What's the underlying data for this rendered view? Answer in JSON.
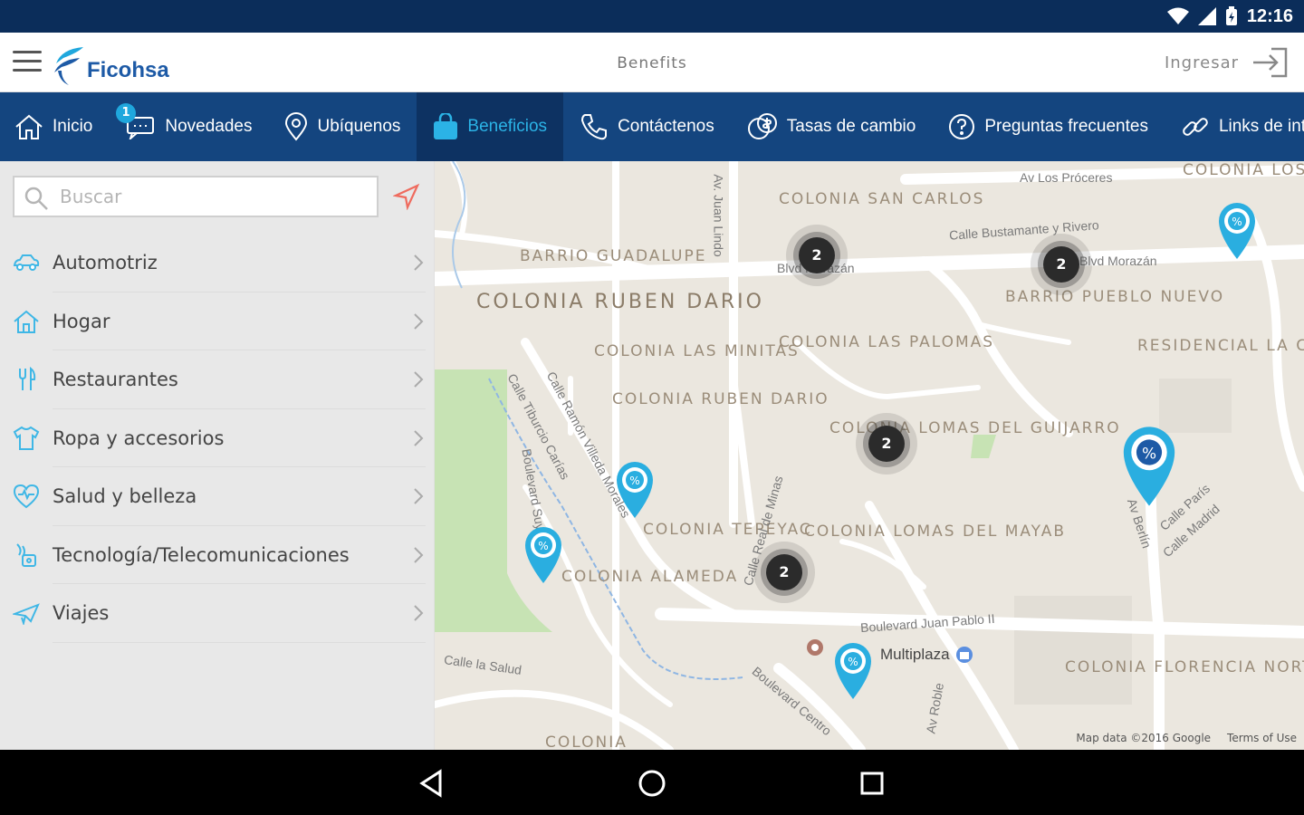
{
  "status": {
    "time": "12:16"
  },
  "appbar": {
    "brand": "Ficohsa",
    "title": "Benefits",
    "login_label": "Ingresar"
  },
  "colors": {
    "navy": "#14457f",
    "active_tab": "#0d3262",
    "accent": "#2bb3e6",
    "status_bar": "#0b2d5a"
  },
  "nav": {
    "badge": "1",
    "tabs": [
      {
        "label": "Inicio",
        "icon": "home-icon"
      },
      {
        "label": "Novedades",
        "icon": "chat-icon"
      },
      {
        "label": "Ubíquenos",
        "icon": "location-pin-icon"
      },
      {
        "label": "Beneficios",
        "icon": "shopping-bag-icon",
        "active": true
      },
      {
        "label": "Contáctenos",
        "icon": "phone-icon"
      },
      {
        "label": "Tasas de cambio",
        "icon": "currency-exchange-icon"
      },
      {
        "label": "Preguntas frecuentes",
        "icon": "help-icon"
      },
      {
        "label": "Links de inter",
        "icon": "link-icon"
      }
    ]
  },
  "sidebar": {
    "search_placeholder": "Buscar",
    "categories": [
      {
        "label": "Automotriz",
        "icon": "car-icon"
      },
      {
        "label": "Hogar",
        "icon": "house-icon"
      },
      {
        "label": "Restaurantes",
        "icon": "fork-knife-icon"
      },
      {
        "label": "Ropa y accesorios",
        "icon": "shirt-icon"
      },
      {
        "label": "Salud y belleza",
        "icon": "heart-icon"
      },
      {
        "label": "Tecnología/Telecomunicaciones",
        "icon": "technology-icon"
      },
      {
        "label": "Viajes",
        "icon": "plane-icon"
      }
    ]
  },
  "map": {
    "neighborhoods": [
      "COLONIA SAN CARLOS",
      "BARRIO GUADALUPE",
      "COLONIA RUBEN DARIO",
      "COLONIA LAS MINITAS",
      "COLONIA RUBEN DARIO",
      "COLONIA LAS PALOMAS",
      "BARRIO PUEBLO NUEVO",
      "RESIDENCIAL LA CUMBRE",
      "COLONIA LOMAS DEL GUIJARRO",
      "COLONIA TEPEYAC",
      "COLONIA ALAMEDA",
      "COLONIA LOMAS DEL MAYAB",
      "COLONIA FLORENCIA NORTE",
      "COLONIA LOS PROCERES",
      "COLONIA"
    ],
    "streets": [
      "Av Los Próceres",
      "Calle Bustamante y Rivero",
      "Blvd Morazán",
      "Blvd Morazán",
      "Av. Juan Lindo",
      "Calle Ramón Villeda Morales",
      "Calle Tiburcio Carías",
      "Boulevard Juan Pablo II",
      "Calle Real de Minas",
      "Av Berlín",
      "Calle París",
      "Calle Madrid",
      "Calle la Salud",
      "Av Roble",
      "Boulevard Suyapa",
      "Boulevard Centro"
    ],
    "clusters": [
      "2",
      "2",
      "2",
      "2"
    ],
    "place": "Multiplaza",
    "attribution": "Map data ©2016 Google",
    "terms": "Terms of Use"
  }
}
